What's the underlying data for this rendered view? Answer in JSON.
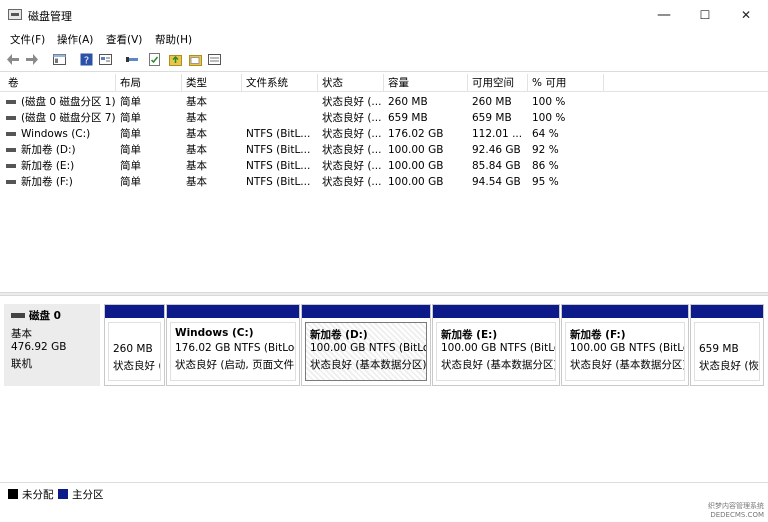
{
  "window": {
    "title": "磁盘管理",
    "minimize": "—",
    "maximize": "☐",
    "close": "✕"
  },
  "menu": [
    "文件(F)",
    "操作(A)",
    "查看(V)",
    "帮助(H)"
  ],
  "toolbar": {
    "icons": [
      "back-arrow-icon",
      "forward-arrow-icon",
      "console-tree-icon",
      "help-icon",
      "properties-icon",
      "connect-icon",
      "check-icon",
      "folder-up-icon",
      "folder-icon",
      "detail-view-icon"
    ]
  },
  "volume_table": {
    "columns": [
      "卷",
      "布局",
      "类型",
      "文件系统",
      "状态",
      "容量",
      "可用空间",
      "% 可用"
    ],
    "rows": [
      [
        "(磁盘 0 磁盘分区 1)",
        "简单",
        "基本",
        "",
        "状态良好 (...",
        "260 MB",
        "260 MB",
        "100 %"
      ],
      [
        "(磁盘 0 磁盘分区 7)",
        "简单",
        "基本",
        "",
        "状态良好 (...",
        "659 MB",
        "659 MB",
        "100 %"
      ],
      [
        "Windows (C:)",
        "简单",
        "基本",
        "NTFS (BitL...",
        "状态良好 (...",
        "176.02 GB",
        "112.01 ...",
        "64 %"
      ],
      [
        "新加卷 (D:)",
        "简单",
        "基本",
        "NTFS (BitL...",
        "状态良好 (...",
        "100.00 GB",
        "92.46 GB",
        "92 %"
      ],
      [
        "新加卷 (E:)",
        "简单",
        "基本",
        "NTFS (BitL...",
        "状态良好 (...",
        "100.00 GB",
        "85.84 GB",
        "86 %"
      ],
      [
        "新加卷 (F:)",
        "简单",
        "基本",
        "NTFS (BitL...",
        "状态良好 (...",
        "100.00 GB",
        "94.54 GB",
        "95 %"
      ]
    ]
  },
  "disk": {
    "name": "磁盘 0",
    "type": "基本",
    "size": "476.92 GB",
    "status": "联机"
  },
  "partitions": [
    {
      "title": "",
      "size": "260 MB",
      "status": "状态良好 ("
    },
    {
      "title": "Windows  (C:)",
      "size": "176.02 GB NTFS (BitLocke",
      "status": "状态良好 (启动, 页面文件"
    },
    {
      "title": "新加卷  (D:)",
      "size": "100.00 GB NTFS (BitLocl",
      "status": "状态良好 (基本数据分区)"
    },
    {
      "title": "新加卷  (E:)",
      "size": "100.00 GB NTFS (BitLocl",
      "status": "状态良好 (基本数据分区)"
    },
    {
      "title": "新加卷  (F:)",
      "size": "100.00 GB NTFS (BitLocl",
      "status": "状态良好 (基本数据分区)"
    },
    {
      "title": "",
      "size": "659 MB",
      "status": "状态良好 (恢"
    }
  ],
  "legend": [
    {
      "label": "未分配",
      "color": "#000000"
    },
    {
      "label": "主分区",
      "color": "#0d1b8a"
    }
  ],
  "watermark": {
    "line1": "织梦内容管理系统",
    "line2": "DEDECMS.COM"
  }
}
